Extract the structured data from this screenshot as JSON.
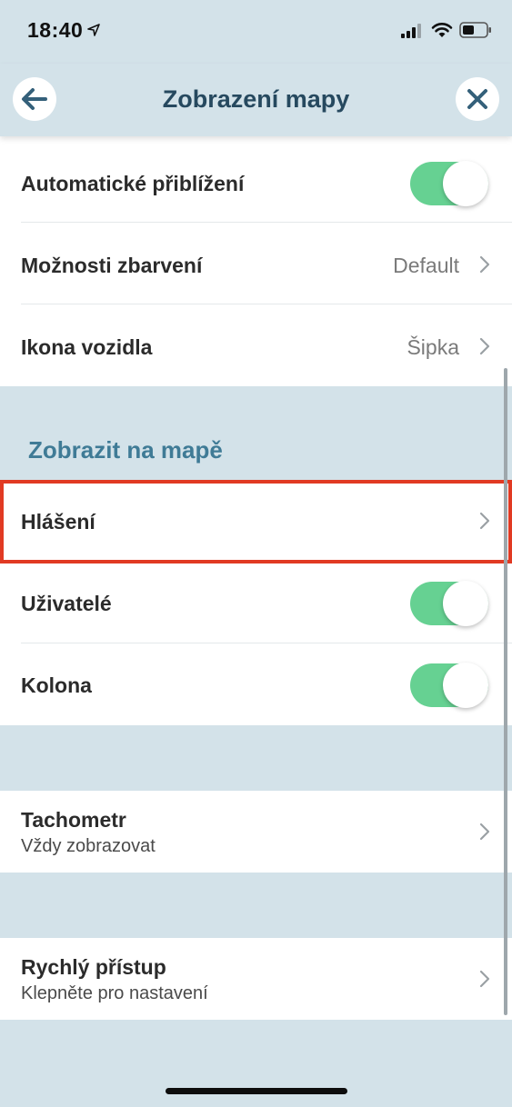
{
  "status_bar": {
    "time": "18:40",
    "location_icon": "location-arrow-icon",
    "signal_icon": "cellular-signal-icon",
    "wifi_icon": "wifi-icon",
    "battery_icon": "battery-icon"
  },
  "header": {
    "title": "Zobrazení mapy",
    "back_icon": "arrow-left-icon",
    "close_icon": "close-icon"
  },
  "general": {
    "auto_zoom": {
      "label": "Automatické přiblížení",
      "enabled": true
    },
    "color_options": {
      "label": "Možnosti zbarvení",
      "value": "Default"
    },
    "vehicle_icon": {
      "label": "Ikona vozidla",
      "value": "Šipka"
    }
  },
  "show_on_map": {
    "section_title": "Zobrazit na mapě",
    "reports": {
      "label": "Hlášení"
    },
    "users": {
      "label": "Uživatelé",
      "enabled": true
    },
    "convoy": {
      "label": "Kolona",
      "enabled": true
    }
  },
  "speedometer": {
    "label": "Tachometr",
    "subtitle": "Vždy zobrazovat"
  },
  "quick_access": {
    "label": "Rychlý přístup",
    "subtitle": "Klepněte pro nastavení"
  },
  "colors": {
    "background": "#d3e2e9",
    "header_title": "#26495f",
    "section_title": "#3f7b96",
    "toggle_on": "#66d192",
    "highlight": "#e13a23"
  }
}
